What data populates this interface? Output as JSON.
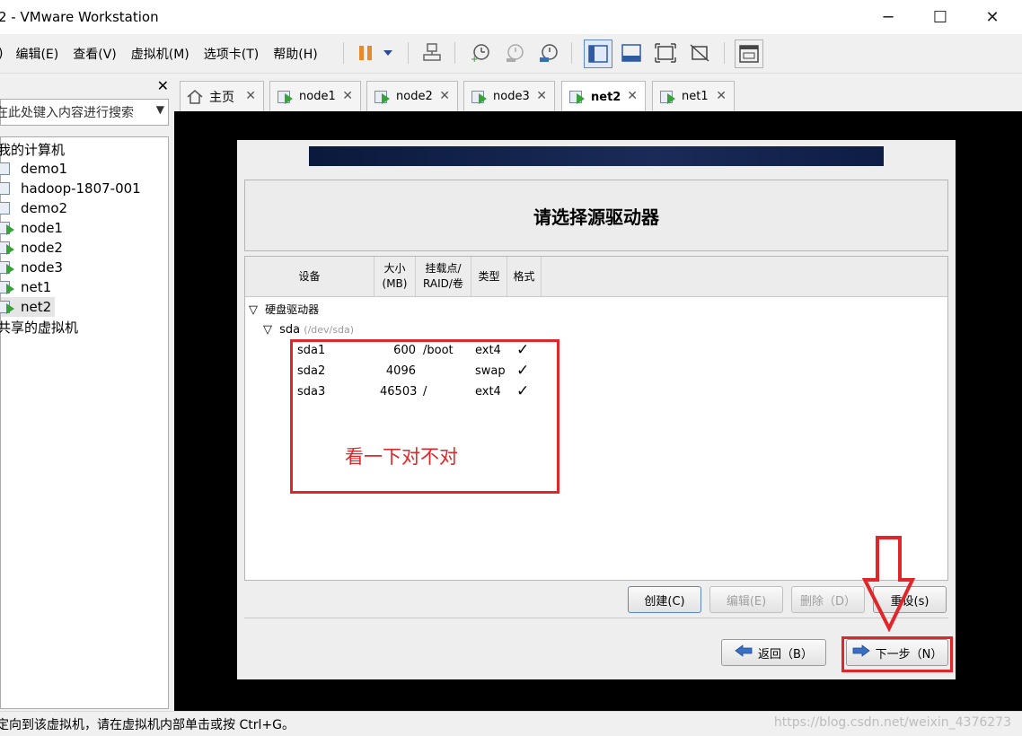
{
  "window": {
    "title": "2 - VMware Workstation",
    "minimize": "─",
    "maximize": "☐",
    "close": "✕"
  },
  "menu": {
    "items": [
      ")",
      "编辑(E)",
      "查看(V)",
      "虚拟机(M)",
      "选项卡(T)",
      "帮助(H)"
    ]
  },
  "sidebar": {
    "close": "✕",
    "search_placeholder": "在此处键入内容进行搜索",
    "tree": {
      "root": "我的计算机",
      "vms": [
        "demo1",
        "hadoop-1807-001",
        "demo2",
        "node1",
        "node2",
        "node3",
        "net1",
        "net2"
      ],
      "shared": "共享的虚拟机"
    }
  },
  "tabs": {
    "items": [
      "主页",
      "node1",
      "node2",
      "node3",
      "net2",
      "net1"
    ],
    "active": "net2",
    "close": "✕"
  },
  "installer": {
    "heading": "请选择源驱动器",
    "columns": {
      "device": "设备",
      "size_line1": "大小",
      "size_line2": "(MB)",
      "mount_line1": "挂载点/",
      "mount_line2": "RAID/卷",
      "type": "类型",
      "format": "格式"
    },
    "group_label": "硬盘驱动器",
    "disk_name": "sda",
    "disk_path": "(/dev/sda)",
    "partitions": [
      {
        "name": "sda1",
        "size": "600",
        "mount": "/boot",
        "type": "ext4",
        "format": "✓"
      },
      {
        "name": "sda2",
        "size": "4096",
        "mount": "",
        "type": "swap",
        "format": "✓"
      },
      {
        "name": "sda3",
        "size": "46503",
        "mount": "/",
        "type": "ext4",
        "format": "✓"
      }
    ],
    "annotation": "看一下对不对",
    "buttons": {
      "create": "创建(C)",
      "edit": "编辑(E)",
      "delete": "删除（D）",
      "reset": "重设(s)",
      "back": "返回（B）",
      "next": "下一步（N）"
    }
  },
  "status": {
    "text": "定向到该虚拟机，请在虚拟机内部单击或按 Ctrl+G。",
    "watermark": "https://blog.csdn.net/weixin_4376273"
  },
  "colors": {
    "annotation_red": "#e0262a",
    "vm_play_green": "#35a335",
    "banner_navy": "#0a1a3c"
  }
}
